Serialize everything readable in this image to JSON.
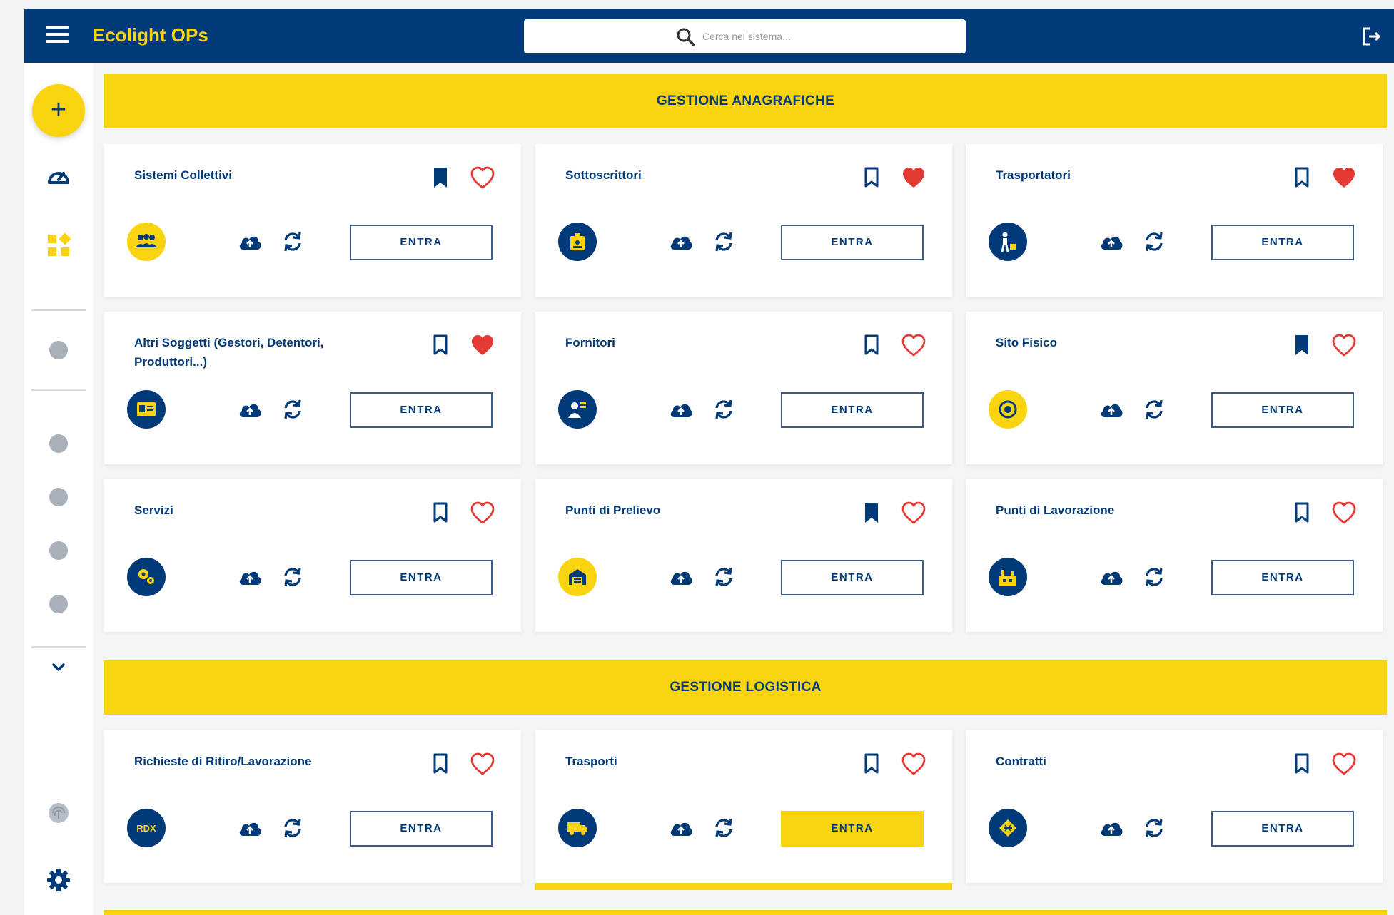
{
  "header": {
    "app_title": "Ecolight OPs",
    "search_placeholder": "Cerca nel sistema..."
  },
  "sections": [
    {
      "title": "GESTIONE ANAGRAFICHE",
      "cards": [
        {
          "title": "Sistemi Collettivi",
          "bookmarked": true,
          "favorite": false,
          "icon": "group-icon",
          "button": "ENTRA"
        },
        {
          "title": "Sottoscrittori",
          "bookmarked": false,
          "favorite": true,
          "icon": "id-badge-icon",
          "button": "ENTRA"
        },
        {
          "title": "Trasportatori",
          "bookmarked": false,
          "favorite": true,
          "icon": "person-cart-icon",
          "button": "ENTRA"
        },
        {
          "title": "Altri Soggetti (Gestori, Detentori, Produttori...)",
          "bookmarked": false,
          "favorite": true,
          "icon": "id-card-icon",
          "button": "ENTRA"
        },
        {
          "title": "Fornitori",
          "bookmarked": false,
          "favorite": false,
          "icon": "supplier-icon",
          "button": "ENTRA"
        },
        {
          "title": "Sito Fisico",
          "bookmarked": true,
          "favorite": false,
          "icon": "target-icon",
          "button": "ENTRA"
        },
        {
          "title": "Servizi",
          "bookmarked": false,
          "favorite": false,
          "icon": "gears-icon",
          "button": "ENTRA"
        },
        {
          "title": "Punti di Prelievo",
          "bookmarked": true,
          "favorite": false,
          "icon": "warehouse-icon",
          "button": "ENTRA"
        },
        {
          "title": "Punti di Lavorazione",
          "bookmarked": false,
          "favorite": false,
          "icon": "factory-icon",
          "button": "ENTRA"
        }
      ]
    },
    {
      "title": "GESTIONE LOGISTICA",
      "cards": [
        {
          "title": "Richieste di Ritiro/Lavorazione",
          "bookmarked": false,
          "favorite": false,
          "icon": "rdx-icon",
          "icon_text": "RDX",
          "button": "ENTRA"
        },
        {
          "title": "Trasporti",
          "bookmarked": false,
          "favorite": false,
          "icon": "truck-icon",
          "button": "ENTRA",
          "active": true
        },
        {
          "title": "Contratti",
          "bookmarked": false,
          "favorite": false,
          "icon": "handshake-icon",
          "button": "ENTRA"
        }
      ]
    }
  ],
  "colors": {
    "navy": "#003a78",
    "yellow": "#f9d40e",
    "heart_red": "#e53935",
    "grey_dot": "#a9b0ba"
  }
}
